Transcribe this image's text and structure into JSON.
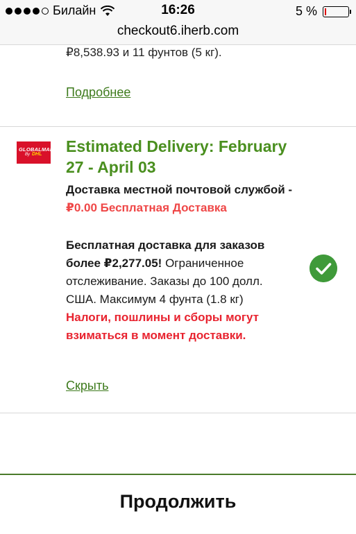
{
  "status_bar": {
    "carrier": "Билайн",
    "time": "16:26",
    "battery": "5 %",
    "battery_level": 0.05
  },
  "browser": {
    "url": "checkout6.iherb.com"
  },
  "previous_option": {
    "price_text": "₽8,538.93 и 11 фунтов (5 кг).",
    "more_link": "Подробнее"
  },
  "shipping_option": {
    "logo_text": [
      "GLOBALMAIL",
      "By",
      "DHL"
    ],
    "estimated_delivery": "Estimated Delivery: February 27 - April 03",
    "method_name": "Доставка местной почтовой службой - ",
    "method_price": "₽0.00 Бесплатная Доставка",
    "free_bold": "Бесплатная доставка для заказов более ₽2,277.05!",
    "free_details": " Ограниченное отслеживание. Заказы до 100 долл. США. Максимум 4 фунта (1.8 кг)",
    "warning": "Налоги, пошлины и сборы могут взиматься в момент доставки.",
    "hide_link": "Скрыть",
    "selected": true
  },
  "footer": {
    "continue_label": "Продолжить"
  },
  "colors": {
    "green_title": "#4a8f1f",
    "link_green": "#3d7a1c",
    "price_red": "#ef4747",
    "warning_red": "#e8232f",
    "check_green": "#3f9a3a",
    "dhl_red": "#d9112a"
  }
}
